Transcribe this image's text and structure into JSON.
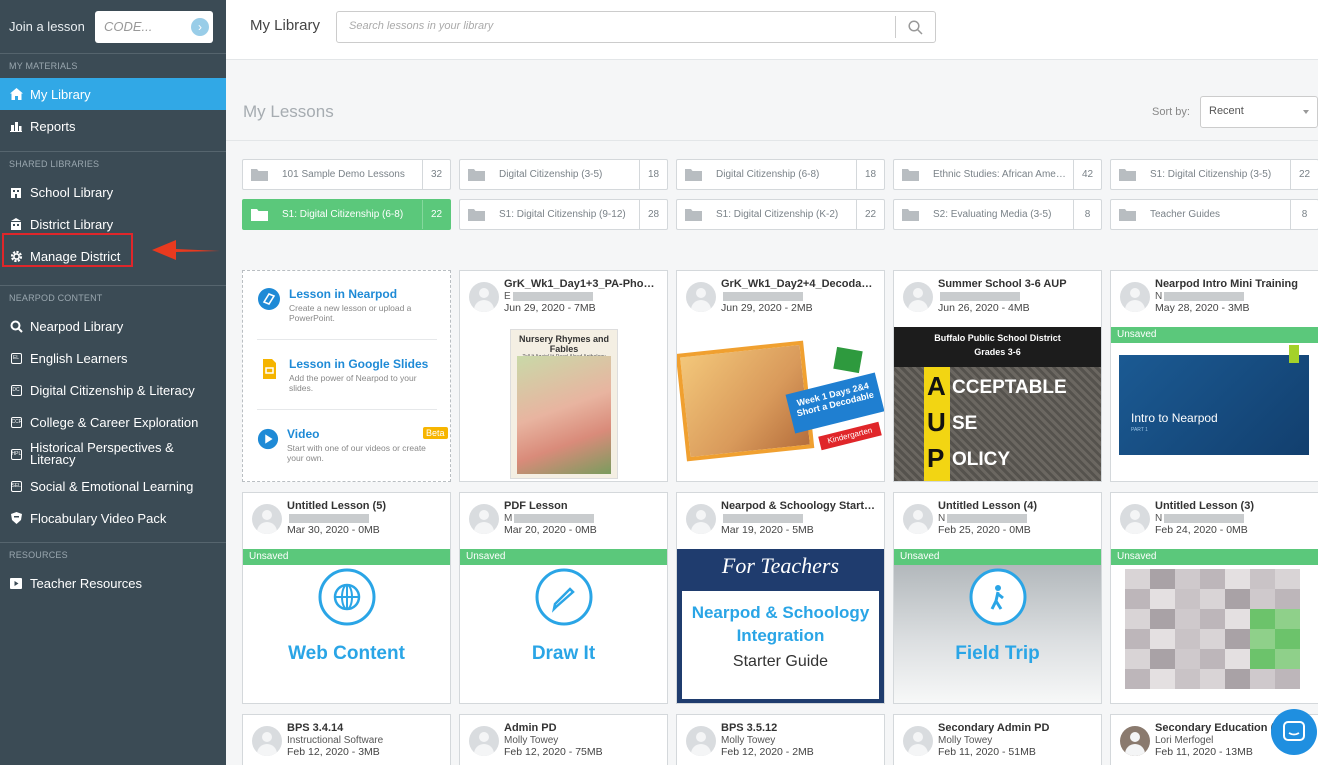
{
  "sidebar": {
    "join_label": "Join a lesson",
    "code_placeholder": "CODE...",
    "sections": {
      "materials": "MY MATERIALS",
      "shared": "SHARED LIBRARIES",
      "content": "NEARPOD CONTENT",
      "resources": "RESOURCES"
    },
    "items": {
      "my_library": "My Library",
      "reports": "Reports",
      "school_library": "School Library",
      "district_library": "District Library",
      "manage_district": "Manage District",
      "nearpod_library": "Nearpod Library",
      "english_learners": "English Learners",
      "digital_citizenship": "Digital Citizenship & Literacy",
      "college_career": "College & Career Exploration",
      "historical_1": "Historical Perspectives &",
      "historical_2": "Literacy",
      "social_emotional": "Social & Emotional Learning",
      "flocabulary": "Flocabulary Video Pack",
      "teacher_resources": "Teacher Resources"
    },
    "icon_badges": {
      "el": "EL",
      "dc": "DC",
      "ccr": "CCR",
      "hpl": "HPL",
      "sel": "SEL"
    }
  },
  "header": {
    "title": "My Library",
    "search_placeholder": "Search lessons in your library"
  },
  "main": {
    "heading": "My Lessons",
    "sort_label": "Sort by:",
    "sort_value": "Recent",
    "folders": [
      {
        "name": "101 Sample Demo Lessons",
        "count": "32"
      },
      {
        "name": "Digital Citizenship (3-5)",
        "count": "18"
      },
      {
        "name": "Digital Citizenship (6-8)",
        "count": "18"
      },
      {
        "name": "Ethnic Studies: African American...",
        "count": "42"
      },
      {
        "name": "S1: Digital Citizenship (3-5)",
        "count": "22"
      },
      {
        "name": "S1: Digital Citizenship (6-8)",
        "count": "22",
        "selected": true
      },
      {
        "name": "S1: Digital Citizenship (9-12)",
        "count": "28"
      },
      {
        "name": "S1: Digital Citizenship (K-2)",
        "count": "22"
      },
      {
        "name": "S2: Evaluating Media (3-5)",
        "count": "8"
      },
      {
        "name": "Teacher Guides",
        "count": "8"
      }
    ],
    "create": {
      "nearpod_title": "Lesson in Nearpod",
      "nearpod_desc": "Create a new lesson or upload a PowerPoint.",
      "slides_title": "Lesson in Google Slides",
      "slides_desc": "Add the power of Nearpod to your slides.",
      "video_title": "Video",
      "video_badge": "Beta",
      "video_desc": "Start with one of our videos or create your own."
    },
    "unsaved_label": "Unsaved",
    "lessons": [
      {
        "title": "GrK_Wk1_Day1+3_PA-Phonics",
        "author": "E",
        "meta": "Jun 29, 2020 - 7MB",
        "thumb_title": "Nursery Rhymes and Fables",
        "thumb_sub": "Tell It Again!™ Read-Aloud Anthology"
      },
      {
        "title": "GrK_Wk1_Day2+4_Decodable",
        "author": "",
        "meta": "Jun 29, 2020 - 2MB",
        "thumb_line1": "Week 1 Days 2&4",
        "thumb_line2": "Short a Decodable",
        "thumb_tag": "Kindergarten"
      },
      {
        "title": "Summer School 3-6 AUP",
        "author": "",
        "meta": "Jun 26, 2020 - 4MB",
        "thumb_line1": "Buffalo Public School District",
        "thumb_line2": "Grades 3-6",
        "aup": [
          "A",
          "U",
          "P"
        ],
        "aup_words": [
          "CCEPTABLE",
          "SE",
          "OLICY"
        ]
      },
      {
        "title": "Nearpod Intro Mini Training",
        "author": "N",
        "meta": "May 28, 2020 - 3MB",
        "unsaved": true,
        "thumb_title": "Intro to Nearpod",
        "thumb_sub": "PART 1"
      },
      {
        "title": "Untitled Lesson (5)",
        "author": "",
        "meta": "Mar 30, 2020 - 0MB",
        "unsaved": true,
        "big": "Web Content"
      },
      {
        "title": "PDF Lesson",
        "author": "M",
        "meta": "Mar 20, 2020 - 0MB",
        "unsaved": true,
        "big": "Draw It"
      },
      {
        "title": "Nearpod & Schoology Starter Guide",
        "author": "",
        "meta": "Mar 19, 2020 - 5MB",
        "thumb_line1": "For Teachers",
        "thumb_line2": "Nearpod & Schoology",
        "thumb_line3": "Integration",
        "thumb_line4": "Starter Guide"
      },
      {
        "title": "Untitled Lesson (4)",
        "author": "N",
        "meta": "Feb 25, 2020 - 0MB",
        "unsaved": true,
        "big": "Field Trip"
      },
      {
        "title": "Untitled Lesson (3)",
        "author": "N",
        "meta": "Feb 24, 2020 - 0MB",
        "unsaved": true
      },
      {
        "title": "BPS 3.4.14",
        "author": "Instructional Software",
        "meta": "Feb 12, 2020 - 3MB"
      },
      {
        "title": "Admin PD",
        "author": "Molly Towey",
        "meta": "Feb 12, 2020 - 75MB"
      },
      {
        "title": "BPS 3.5.12",
        "author": "Molly Towey",
        "meta": "Feb 12, 2020 - 2MB"
      },
      {
        "title": "Secondary Admin PD",
        "author": "Molly Towey",
        "meta": "Feb 11, 2020 - 51MB"
      },
      {
        "title": "Secondary Education (",
        "author": "Lori Merfogel",
        "meta": "Feb 11, 2020 - 13MB"
      }
    ]
  },
  "colors": {
    "sidebar": "#3b4b55",
    "active": "#31a8e6",
    "green": "#5bc87b",
    "blue": "#2aa5e6",
    "highlight": "#e0262a"
  }
}
